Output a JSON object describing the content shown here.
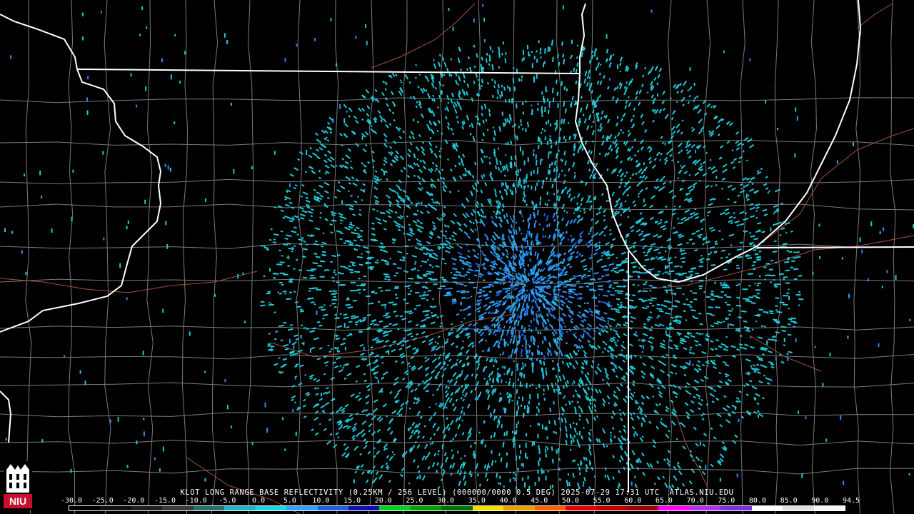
{
  "product": {
    "caption": "KLOT LONG RANGE BASE REFLECTIVITY (0.25KM / 256 LEVEL) (000000/0000 0.5 DEG) 2025-07-29 17:31 UTC  ATLAS.NIU.EDU",
    "radar_site": "KLOT",
    "elevation_deg": "0.5 DEG",
    "timestamp": "2025-07-29 17:31 UTC",
    "source": "ATLAS.NIU.EDU"
  },
  "logo": {
    "text": "NIU",
    "icon": "niu-castle-logo-icon",
    "color": "#c8102e"
  },
  "colorbar": {
    "labels": [
      "-30.0",
      "-25.0",
      "-20.0",
      "-15.0",
      "-10.0",
      "-5.0",
      "0.0",
      "5.0",
      "10.0",
      "15.0",
      "20.0",
      "25.0",
      "30.0",
      "35.0",
      "40.0",
      "45.0",
      "50.0",
      "55.0",
      "60.0",
      "65.0",
      "70.0",
      "75.0",
      "80.0",
      "85.0",
      "90.0",
      "94.5"
    ],
    "colors": [
      "#000000",
      "#101010",
      "#202020",
      "#3a3a3a",
      "#2a6f6f",
      "#1fb7c7",
      "#1fd5e0",
      "#33a0ff",
      "#1f5fe0",
      "#1010b0",
      "#00d020",
      "#00a000",
      "#007000",
      "#f2e000",
      "#e8a000",
      "#ff6000",
      "#e00000",
      "#c00000",
      "#a00000",
      "#ff00ff",
      "#b030f0",
      "#7f2fdf",
      "#ffffff",
      "#e0e0e0",
      "#f8f8f8"
    ]
  },
  "map": {
    "background": "#000000",
    "state_border_color": "#ffffff",
    "county_border_color": "#7a7a7a",
    "highway_color": "#a4503a",
    "echo_colors": [
      "#1fc9d6",
      "#27b6e6",
      "#2f8ef0",
      "#1b5fe0"
    ]
  }
}
